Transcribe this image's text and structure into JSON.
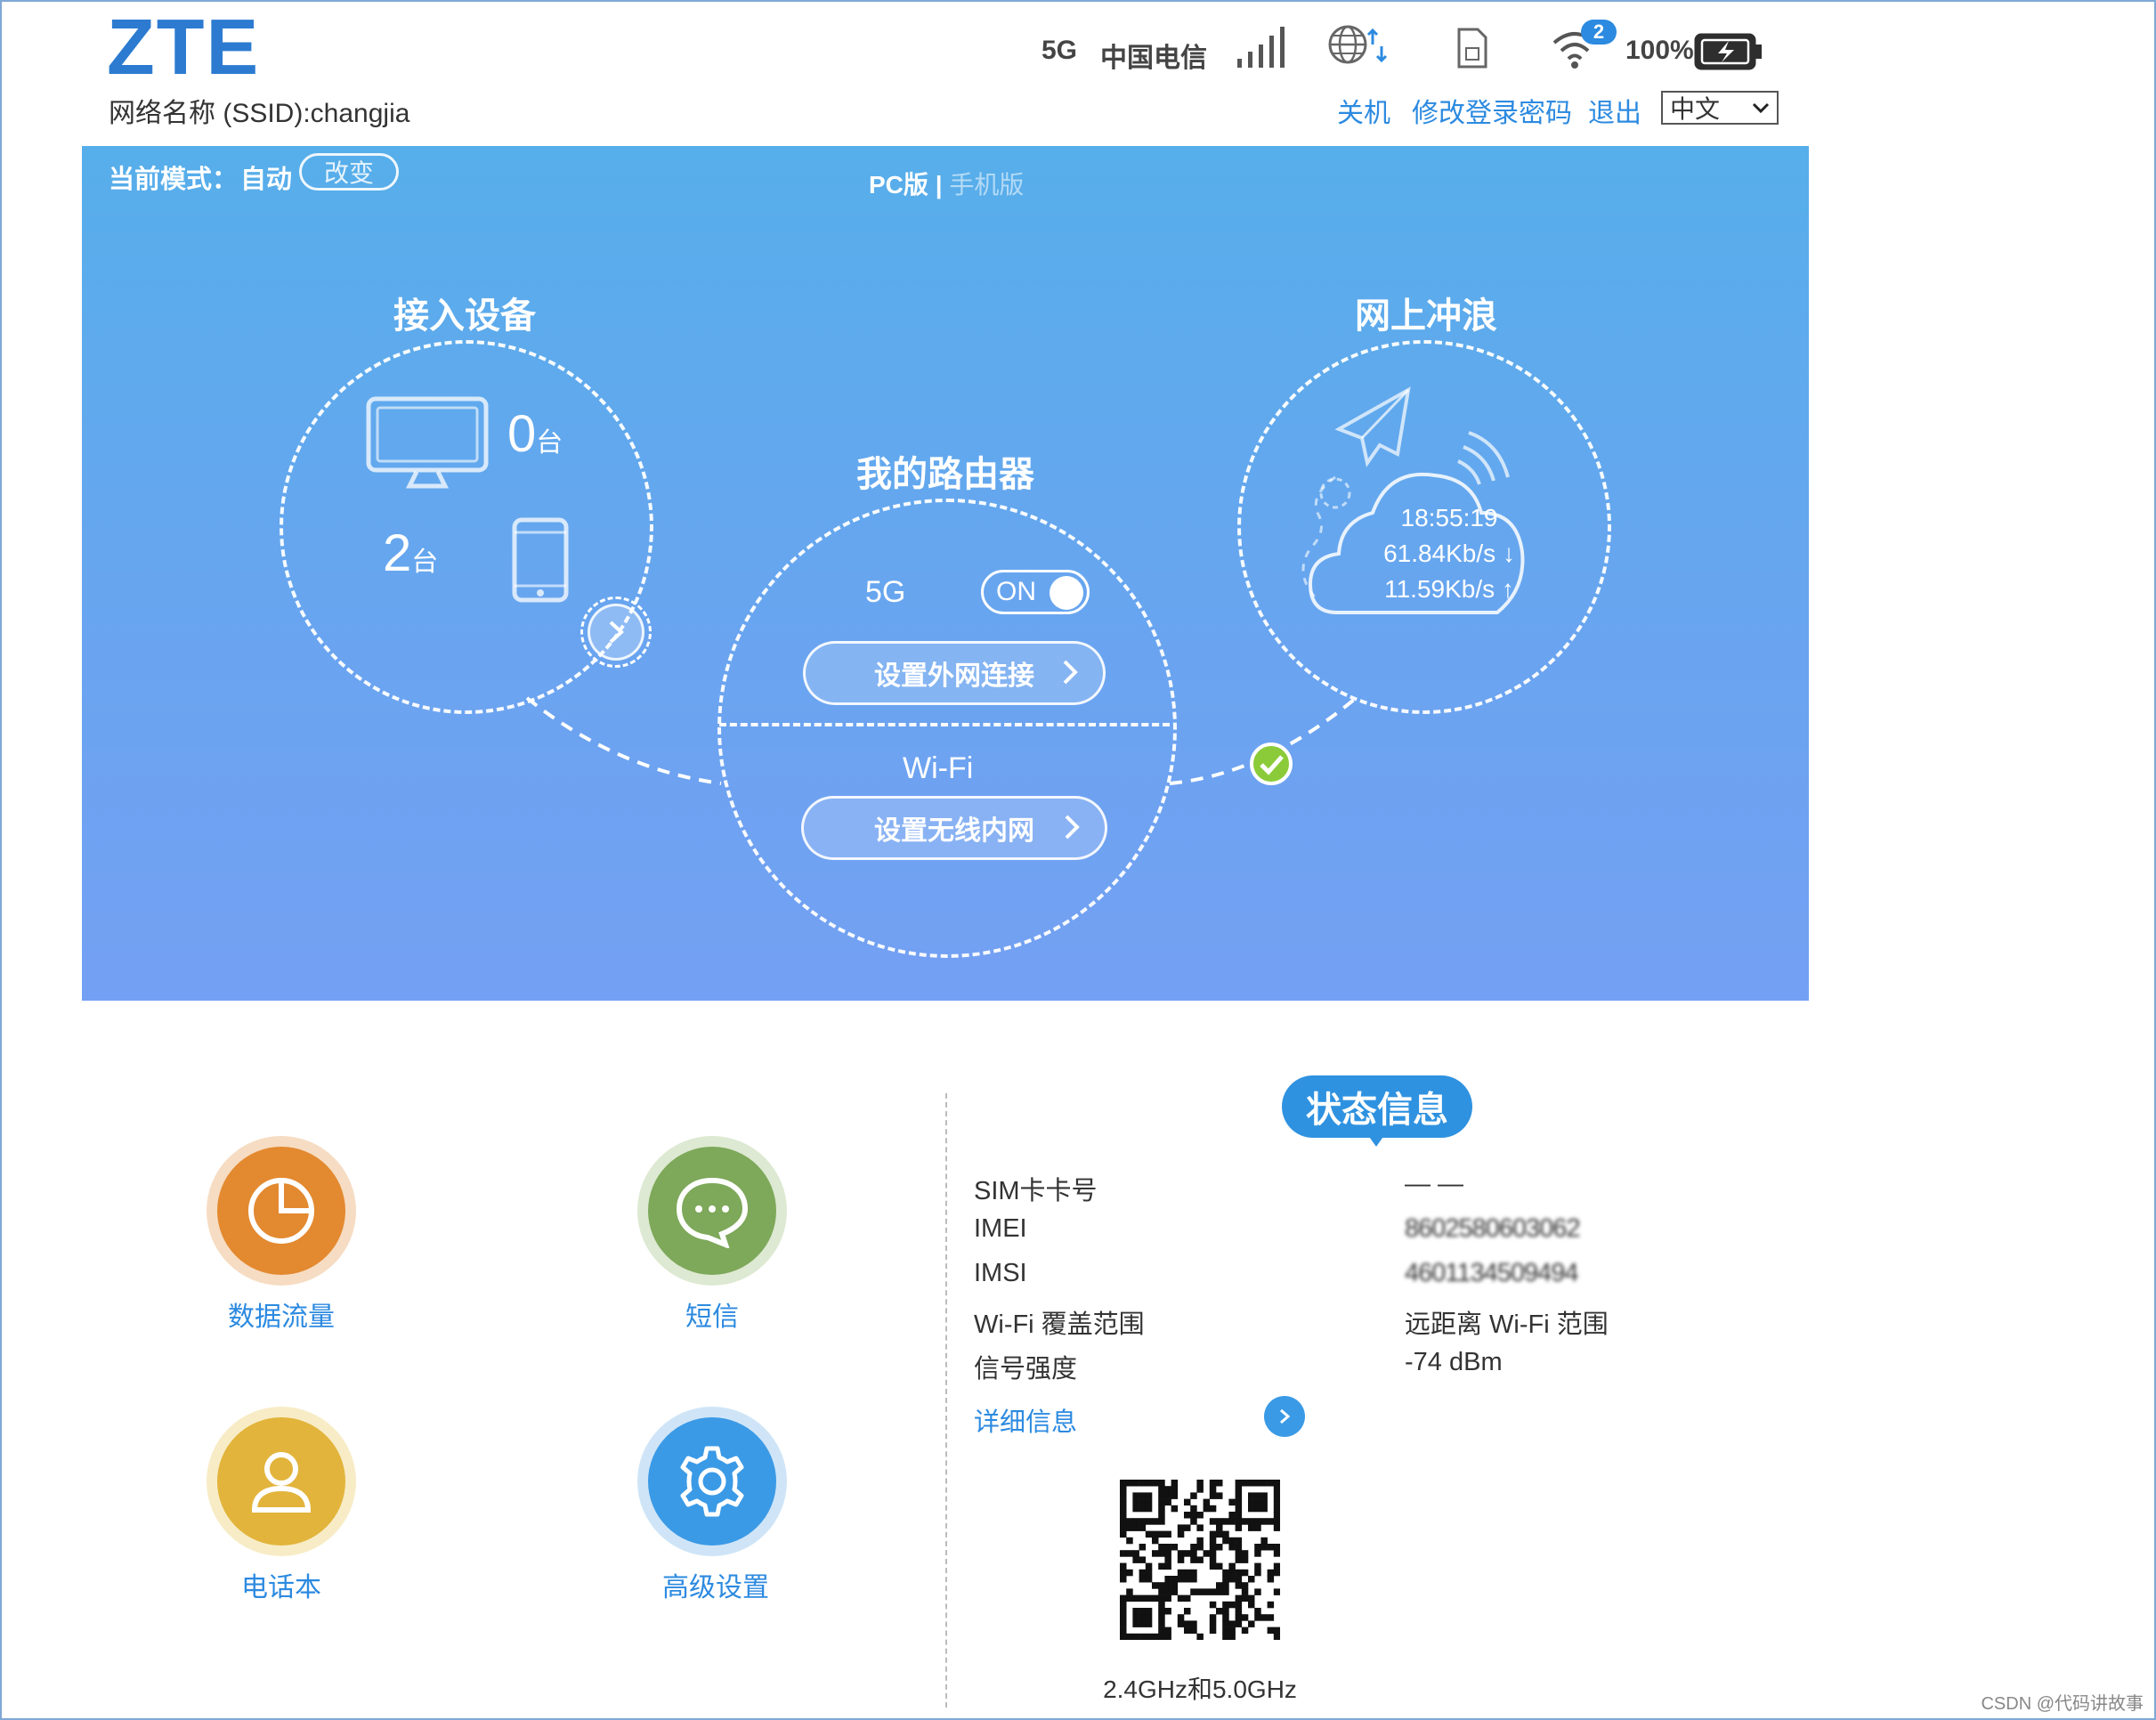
{
  "header": {
    "logo": "ZTE",
    "ssid": "网络名称 (SSID):changjia",
    "network_type": "5G",
    "carrier": "中国电信",
    "wifi_clients": "2",
    "battery": "100%",
    "links": {
      "shutdown": "关机",
      "change_password": "修改登录密码",
      "logout": "退出"
    },
    "language": "中文"
  },
  "hero": {
    "mode_label": "当前模式：",
    "mode_value": "自动",
    "change_button": "改变",
    "view_pc": "PC版",
    "view_sep": "|",
    "view_mobile": "手机版",
    "devices": {
      "title": "接入设备",
      "pc_count": "0",
      "phone_count": "2",
      "unit": "台"
    },
    "router": {
      "title": "我的路由器",
      "band": "5G",
      "toggle": "ON",
      "wan_button": "设置外网连接",
      "wifi_label": "Wi-Fi",
      "wifi_button": "设置无线内网"
    },
    "internet": {
      "title": "网上冲浪",
      "time": "18:55:19",
      "down": "61.84Kb/s ↓",
      "up": "11.59Kb/s ↑"
    }
  },
  "tiles": [
    {
      "label": "数据流量",
      "icon": "pie-chart-icon",
      "color": "#e3892f"
    },
    {
      "label": "短信",
      "icon": "chat-bubble-icon",
      "color": "#7ea85a"
    },
    {
      "label": "电话本",
      "icon": "contact-icon",
      "color": "#e2b43b"
    },
    {
      "label": "高级设置",
      "icon": "gear-icon",
      "color": "#3b9ae6"
    }
  ],
  "status": {
    "title": "状态信息",
    "rows": [
      {
        "key": "SIM卡卡号",
        "value": "— —"
      },
      {
        "key": "IMEI",
        "value": "8602580603062"
      },
      {
        "key": "IMSI",
        "value": "4601134509494"
      },
      {
        "key": "Wi-Fi 覆盖范围",
        "value": "远距离 Wi-Fi 范围"
      },
      {
        "key": "信号强度",
        "value": "-74 dBm"
      }
    ],
    "detail_link": "详细信息",
    "qr_caption": "2.4GHz和5.0GHz"
  },
  "watermark": "CSDN @代码讲故事"
}
